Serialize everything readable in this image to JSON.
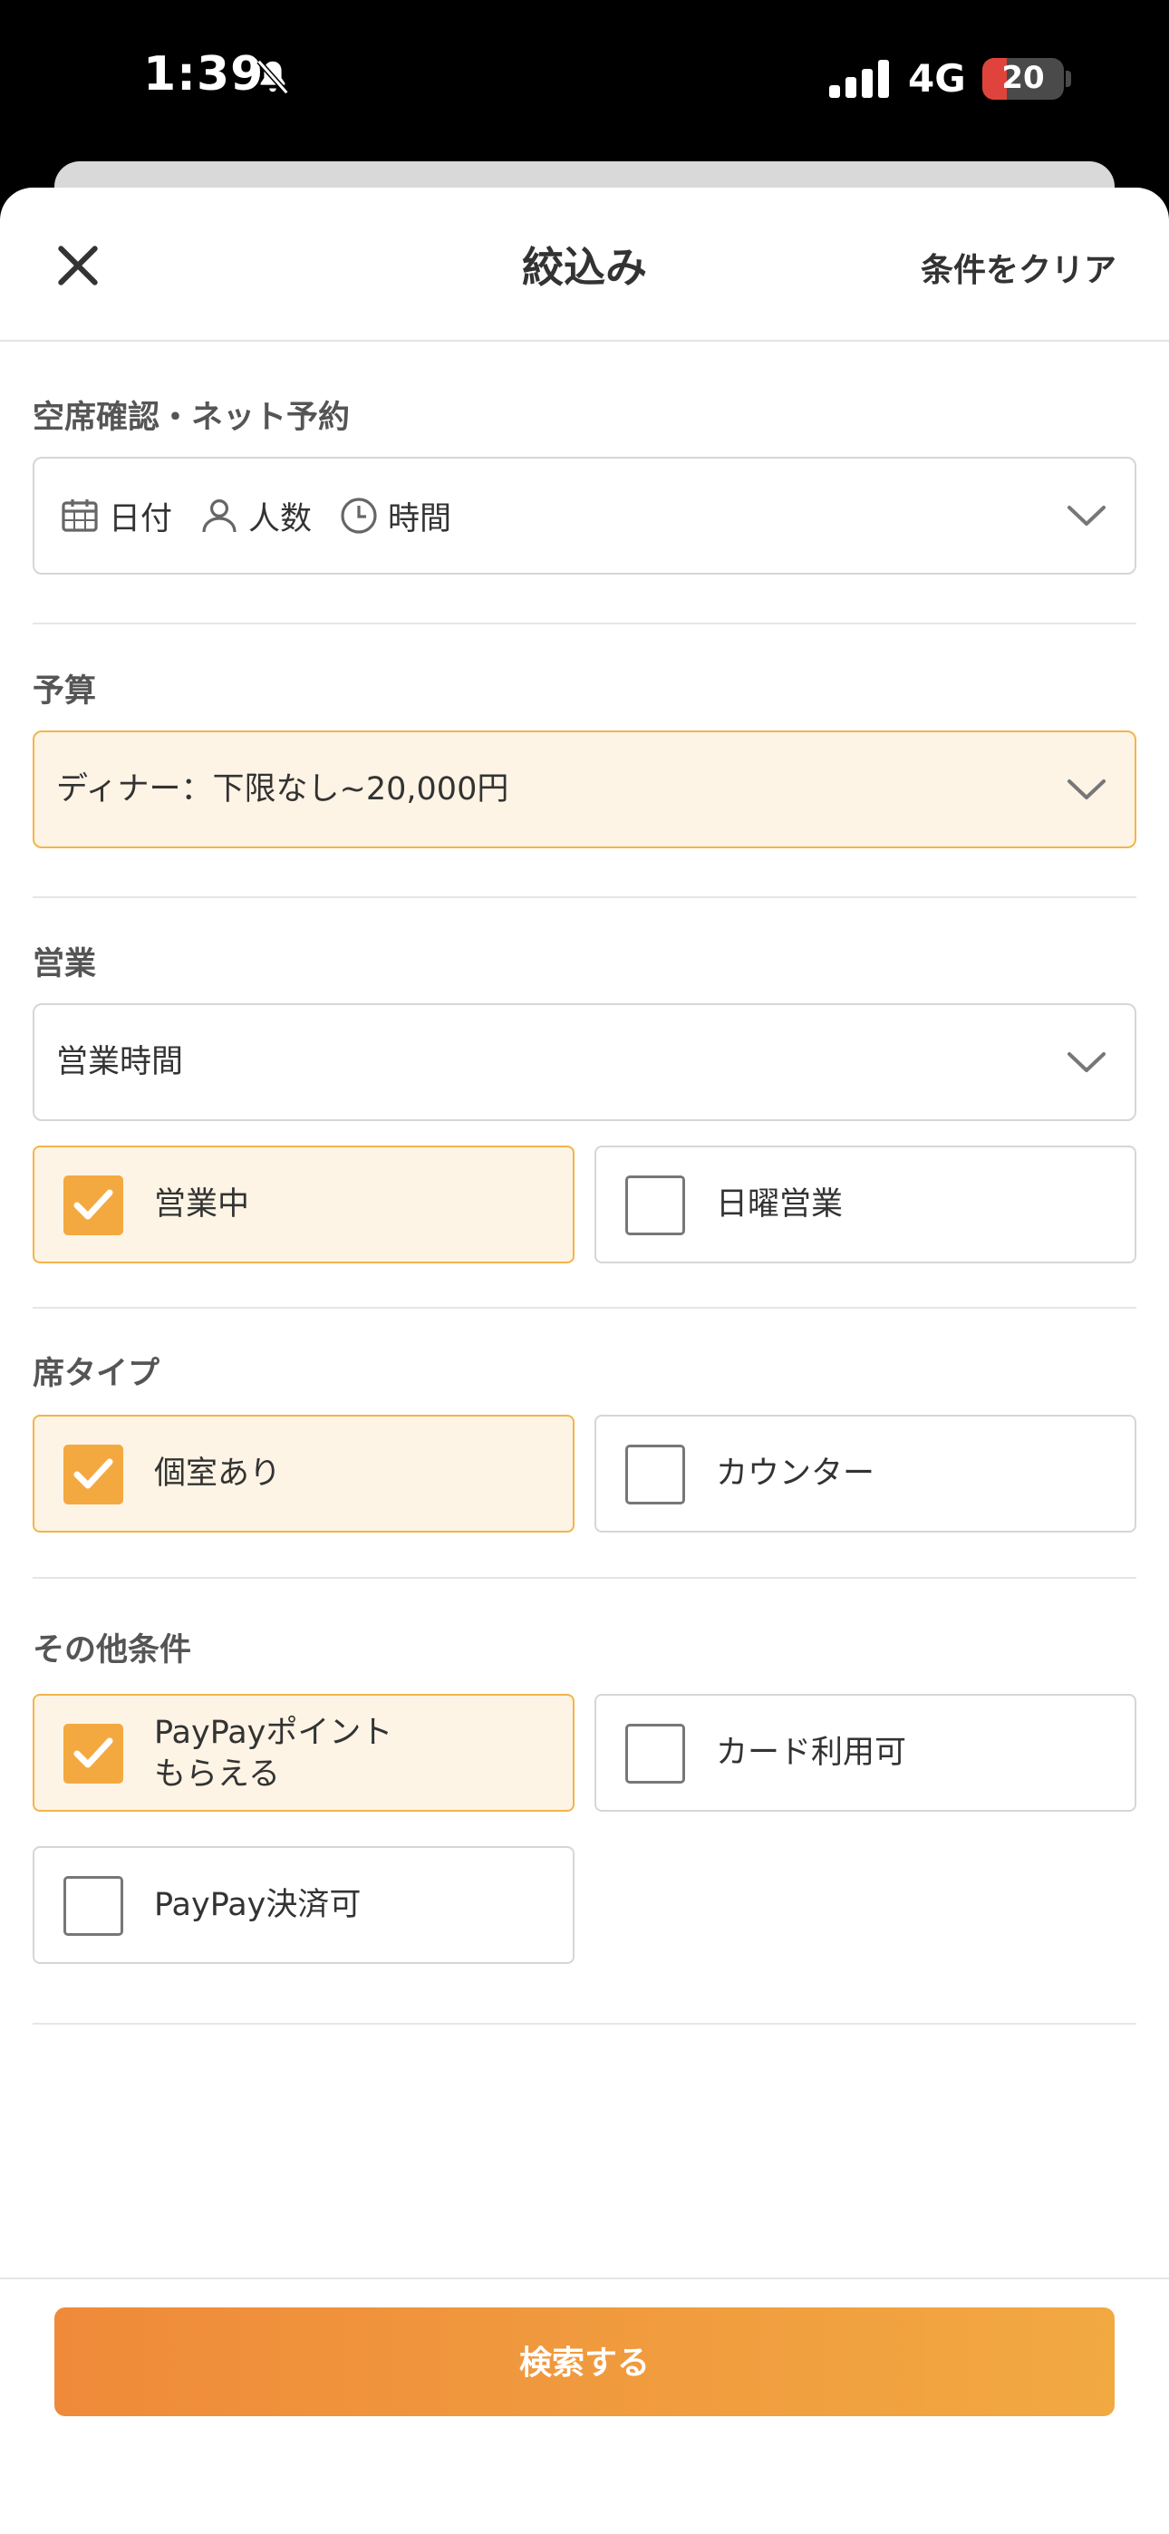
{
  "status_bar": {
    "time": "1:39",
    "network": "4G",
    "battery": "20",
    "battery_level": 0.2,
    "icons": [
      "bell-slash-icon",
      "signal-icon"
    ]
  },
  "header": {
    "title": "絞込み",
    "clear_label": "条件をクリア",
    "close_icon": "close-icon"
  },
  "availability": {
    "title": "空席確認・ネット予約",
    "date_label": "日付",
    "people_label": "人数",
    "time_label": "時間",
    "icons": [
      "calendar-icon",
      "person-icon",
      "clock-icon",
      "chevron-down-icon"
    ]
  },
  "budget": {
    "title": "予算",
    "value": "ディナー：下限なし~20,000円"
  },
  "business": {
    "title": "営業",
    "hours_value": "営業時間",
    "options": [
      {
        "label": "営業中",
        "checked": true
      },
      {
        "label": "日曜営業",
        "checked": false
      }
    ]
  },
  "seat_type": {
    "title": "席タイプ",
    "options": [
      {
        "label": "個室あり",
        "checked": true
      },
      {
        "label": "カウンター",
        "checked": false
      }
    ]
  },
  "other": {
    "title": "その他条件",
    "options": [
      {
        "label_line1": "PayPayポイント",
        "label_line2": "もらえる",
        "checked": true
      },
      {
        "label": "カード利用可",
        "checked": false
      },
      {
        "label": "PayPay決済可",
        "checked": false
      }
    ]
  },
  "search_button": "検索する",
  "colors": {
    "accent": "#f4a940",
    "selected_bg": "#fdf4e5",
    "selected_border": "#f3b44a",
    "button_start": "#ef8a3a",
    "button_end": "#f2a942"
  }
}
